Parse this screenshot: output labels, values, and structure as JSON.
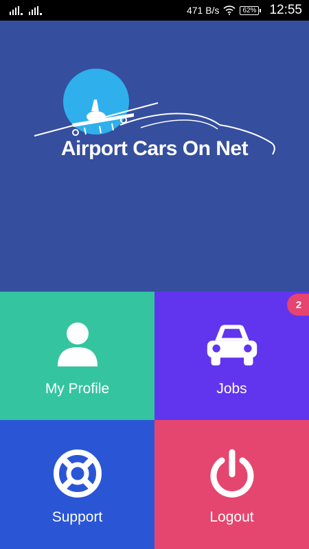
{
  "status_bar": {
    "speed": "471 B/s",
    "battery": "62%",
    "time": "12:55",
    "icons": [
      "signal-icon",
      "signal-icon",
      "wifi-icon",
      "battery-icon"
    ]
  },
  "app": {
    "logo_text": "Airport Cars On Net"
  },
  "tiles": {
    "profile": {
      "label": "My Profile",
      "icon": "user-icon",
      "color": "#34c4a0"
    },
    "jobs": {
      "label": "Jobs",
      "icon": "car-icon",
      "color": "#6135ee",
      "badge": "2"
    },
    "support": {
      "label": "Support",
      "icon": "lifebuoy-icon",
      "color": "#2a56d6"
    },
    "logout": {
      "label": "Logout",
      "icon": "power-icon",
      "color": "#e5466f"
    }
  },
  "colors": {
    "hero_background": "#354e9e",
    "badge": "#e7446f",
    "logo_sun": "#2fb0ec"
  }
}
